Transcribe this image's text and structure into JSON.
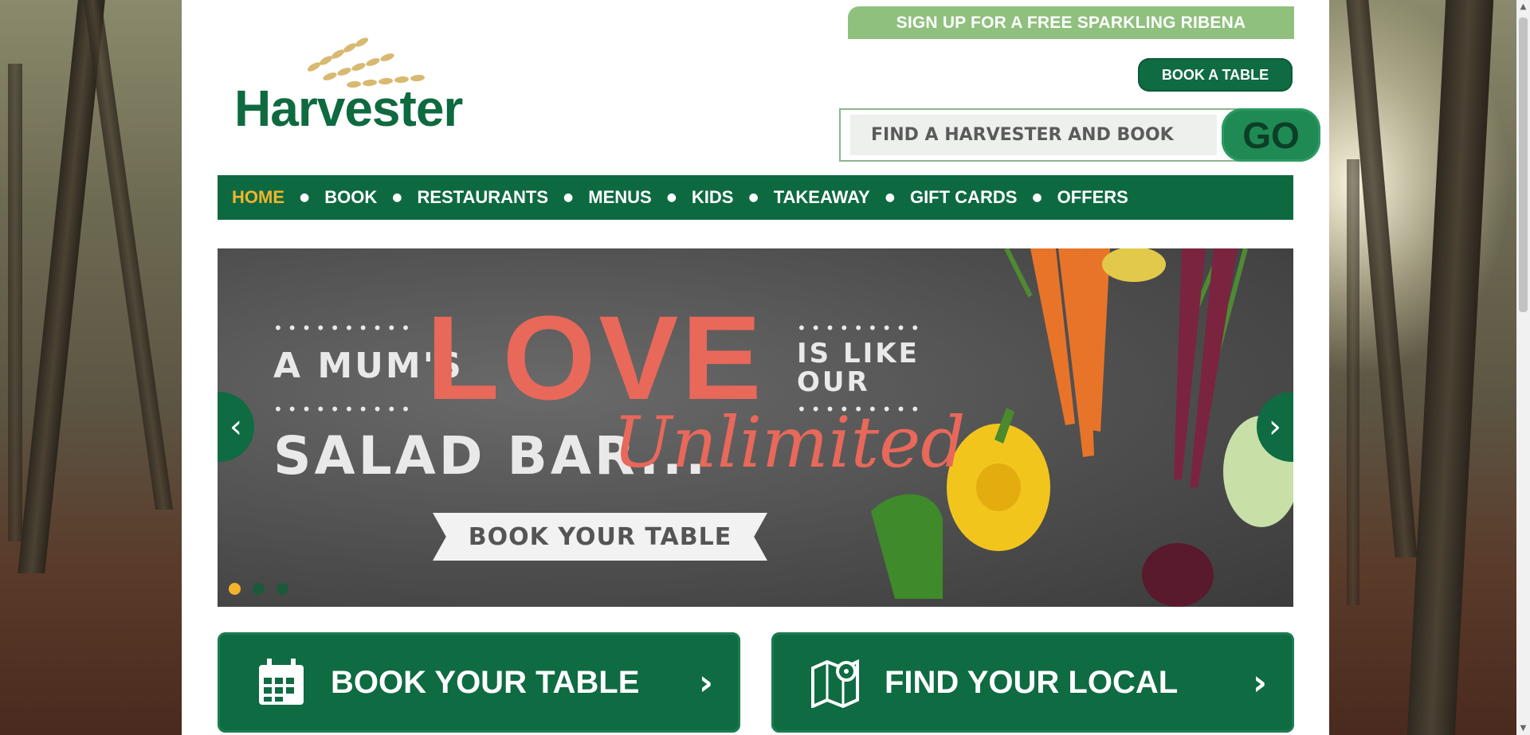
{
  "header": {
    "signup_text": "SIGN UP FOR A FREE SPARKLING RIBENA",
    "book_table_label": "BOOK A TABLE",
    "search_placeholder": "FIND A HARVESTER AND BOOK",
    "go_label": "GO",
    "logo_text": "Harvester"
  },
  "nav": {
    "items": [
      {
        "label": "HOME",
        "active": true
      },
      {
        "label": "BOOK"
      },
      {
        "label": "RESTAURANTS"
      },
      {
        "label": "MENUS"
      },
      {
        "label": "KIDS"
      },
      {
        "label": "TAKEAWAY"
      },
      {
        "label": "GIFT CARDS"
      },
      {
        "label": "OFFERS"
      }
    ]
  },
  "hero": {
    "line1": "A MUM'S",
    "love": "LOVE",
    "is_like": "IS LIKE",
    "our": "OUR",
    "salad_bar": "SALAD BAR...",
    "unlimited": "Unlimited",
    "cta": "BOOK YOUR TABLE",
    "slide_count": 3,
    "active_slide": 1
  },
  "ctas": [
    {
      "label": "BOOK YOUR TABLE",
      "icon": "calendar-icon"
    },
    {
      "label": "FIND YOUR LOCAL",
      "icon": "map-pin-icon"
    }
  ],
  "colors": {
    "brand_green": "#0f6b42",
    "signup_green": "#8fc07e",
    "active_nav": "#f3b42a",
    "hero_accent": "#e8685a"
  }
}
